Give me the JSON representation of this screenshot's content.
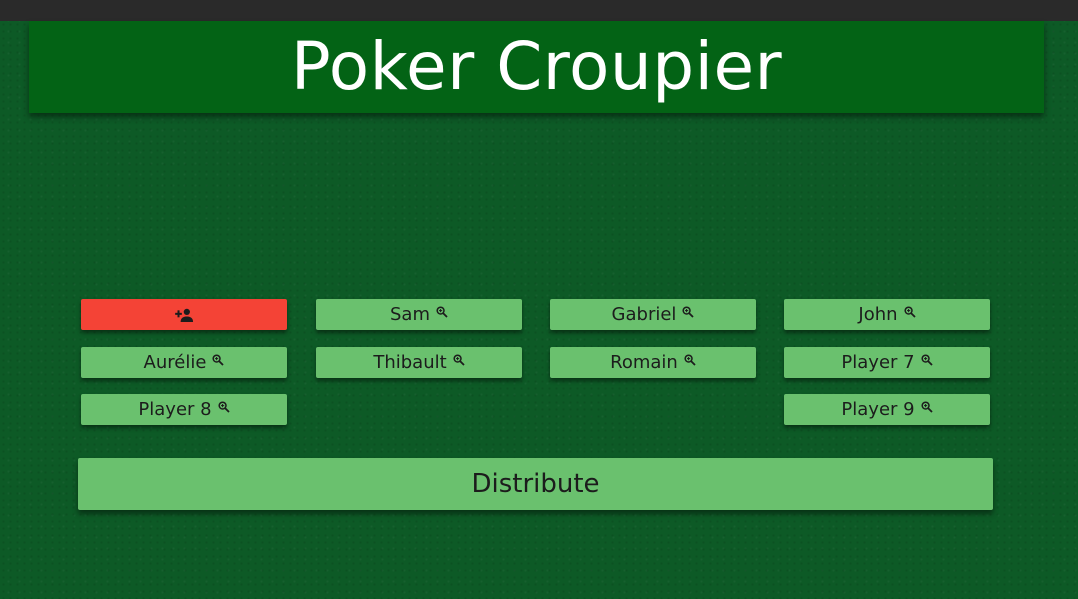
{
  "app": {
    "title": "Poker Croupier"
  },
  "players": {
    "add_icon": "person-add-icon",
    "search_icon": "magnifier-zoom-icon",
    "row1": [
      "Sam",
      "Gabriel",
      "John"
    ],
    "row2": [
      "Aurélie",
      "Thibault",
      "Romain",
      "Player 7"
    ],
    "row3": [
      "Player 8",
      "Player 9"
    ]
  },
  "actions": {
    "distribute_label": "Distribute"
  },
  "colors": {
    "table_felt": "#0d5a26",
    "title_banner": "#036315",
    "player_button": "#6ac16e",
    "add_button": "#f44336"
  }
}
